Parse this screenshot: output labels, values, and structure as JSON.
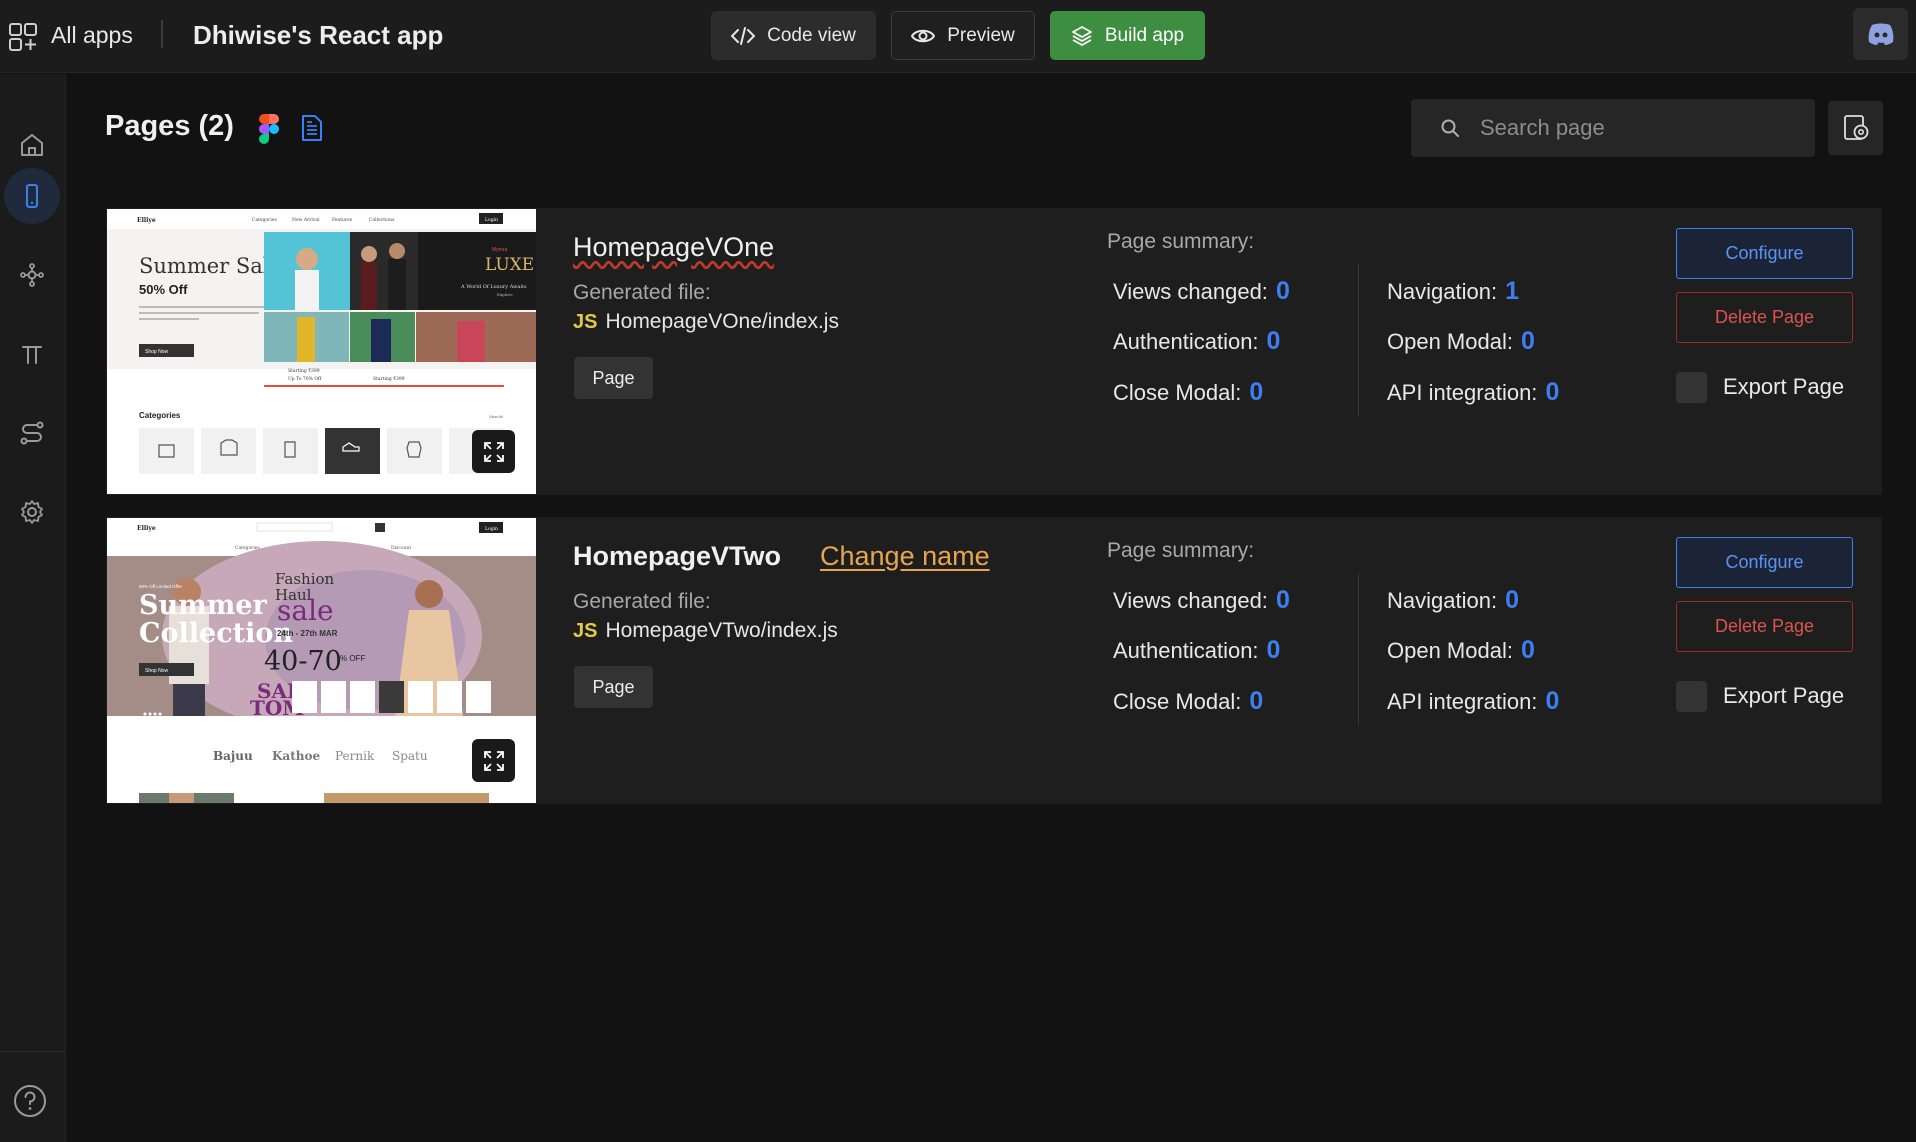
{
  "topbar": {
    "all_apps": "All apps",
    "app_title": "Dhiwise's React app",
    "code_view": "Code view",
    "preview": "Preview",
    "build_app": "Build app"
  },
  "header": {
    "pages_title": "Pages (2)",
    "search_placeholder": "Search page"
  },
  "colors": {
    "accent_blue": "#3d7ef0",
    "build_green": "#3e8e41",
    "danger_red": "#d9534f",
    "link_orange": "#e8a550",
    "js_yellow": "#e3c94a"
  },
  "pages": [
    {
      "name": "HomepageVOne",
      "change_name": "",
      "generated_label": "Generated file:",
      "js_badge": "JS",
      "file": "HomepageVOne/index.js",
      "tag": "Page",
      "summary_label": "Page summary:",
      "stats": {
        "views_changed": {
          "label": "Views changed:",
          "value": "0"
        },
        "authentication": {
          "label": "Authentication:",
          "value": "0"
        },
        "close_modal": {
          "label": "Close Modal:",
          "value": "0"
        },
        "navigation": {
          "label": "Navigation:",
          "value": "1"
        },
        "open_modal": {
          "label": "Open Modal:",
          "value": "0"
        },
        "api_integration": {
          "label": "API integration:",
          "value": "0"
        }
      },
      "configure": "Configure",
      "delete": "Delete Page",
      "export": "Export Page",
      "thumb": {
        "brand": "Elliye",
        "nav": [
          "Categories",
          "New Arrival",
          "Features",
          "Collections"
        ],
        "login": "Login",
        "headline": "Summer Sale",
        "offer": "50% Off",
        "shop_now": "Shop Now",
        "luxe_brand": "Myntra",
        "luxe": "LUXE",
        "luxe_sub": "A World Of Luxury Awaits",
        "luxe_cta": "Explore",
        "categories": "Categories",
        "view_all": "View All",
        "price_1": "Starting ₹399",
        "price_2": "Up To 70% Off",
        "price_3": "Starting ₹399"
      }
    },
    {
      "name": "HomepageVTwo",
      "change_name": "Change name",
      "generated_label": "Generated file:",
      "js_badge": "JS",
      "file": "HomepageVTwo/index.js",
      "tag": "Page",
      "summary_label": "Page summary:",
      "stats": {
        "views_changed": {
          "label": "Views changed:",
          "value": "0"
        },
        "authentication": {
          "label": "Authentication:",
          "value": "0"
        },
        "close_modal": {
          "label": "Close Modal:",
          "value": "0"
        },
        "navigation": {
          "label": "Navigation:",
          "value": "0"
        },
        "open_modal": {
          "label": "Open Modal:",
          "value": "0"
        },
        "api_integration": {
          "label": "API integration:",
          "value": "0"
        }
      },
      "configure": "Configure",
      "delete": "Delete Page",
      "export": "Export Page",
      "thumb": {
        "brand": "Elliye",
        "nav": [
          "Categories",
          "New Arrival",
          "Features",
          "Collections",
          "Discount"
        ],
        "login": "Login",
        "tagline": "50% Off Limited Offer",
        "headline_1": "Summer",
        "headline_2": "Collection",
        "fashion": "Fashion",
        "haul": "Haul",
        "sale": "sale",
        "dates": "24th - 27th MAR",
        "percent": "40-70",
        "off": "% OFF",
        "shop_now": "Shop Now",
        "sal": "SALI",
        "tom": "TOM",
        "brands": [
          "Bajuu",
          "Kathoe",
          "Pernik",
          "Spatu"
        ]
      }
    }
  ]
}
